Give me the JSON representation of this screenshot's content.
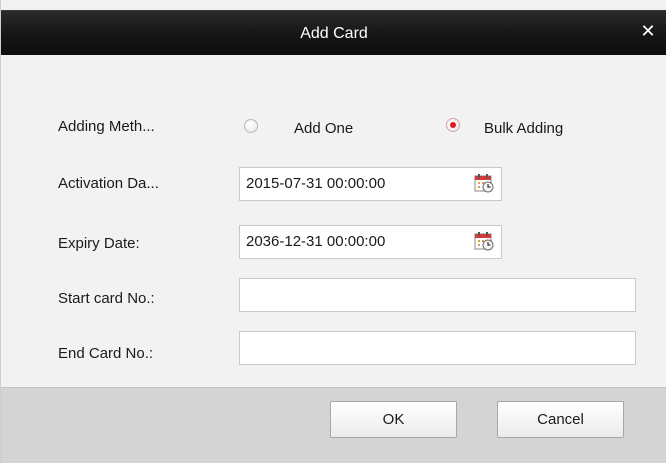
{
  "dialog": {
    "title": "Add Card",
    "close_icon": "close-icon"
  },
  "form": {
    "adding_method": {
      "label": "Adding Meth...",
      "options": [
        {
          "label": "Add One",
          "checked": false
        },
        {
          "label": "Bulk Adding",
          "checked": true
        }
      ]
    },
    "activation_date": {
      "label": "Activation Da...",
      "value": "2015-07-31 00:00:00",
      "icon": "calendar-icon"
    },
    "expiry_date": {
      "label": "Expiry Date:",
      "value": "2036-12-31 00:00:00",
      "icon": "calendar-icon"
    },
    "start_card": {
      "label": "Start card No.:",
      "value": ""
    },
    "end_card": {
      "label": "End Card No.:",
      "value": ""
    }
  },
  "buttons": {
    "ok": "OK",
    "cancel": "Cancel"
  },
  "colors": {
    "titlebar": "#151515",
    "radio_selected": "#e51b1b",
    "footer": "#d4d4d4"
  }
}
